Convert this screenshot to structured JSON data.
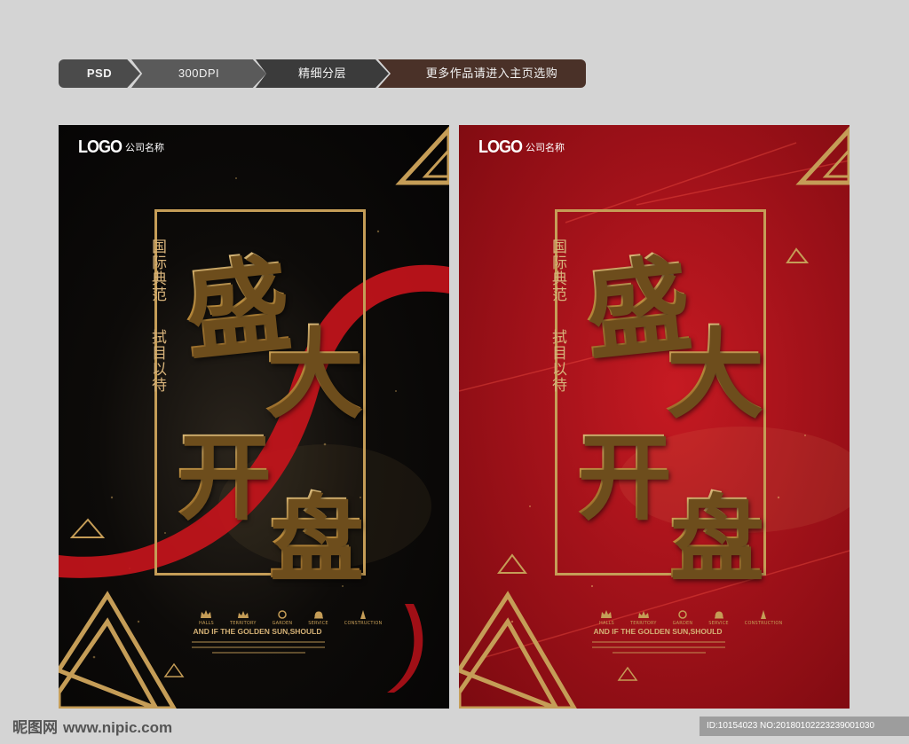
{
  "header": {
    "crumbs": [
      "PSD",
      "300DPI",
      "精细分层",
      "更多作品请进入主页选购"
    ]
  },
  "posters": [
    {
      "variant": "black",
      "logo_mark": "LOGO",
      "logo_name": "公司名称",
      "side_text_1": "国际典范",
      "side_text_2": "拭目以待",
      "title_chars": [
        "盛",
        "大",
        "开",
        "盘"
      ],
      "icon_labels": [
        "HALLS",
        "TERRITORY",
        "GARDEN",
        "SERVICE",
        "CONSTRUCTION"
      ],
      "tagline": "AND IF THE GOLDEN SUN,SHOULD"
    },
    {
      "variant": "red",
      "logo_mark": "LOGO",
      "logo_name": "公司名称",
      "side_text_1": "国际典范",
      "side_text_2": "拭目以待",
      "title_chars": [
        "盛",
        "大",
        "开",
        "盘"
      ],
      "icon_labels": [
        "HALLS",
        "TERRITORY",
        "GARDEN",
        "SERVICE",
        "CONSTRUCTION"
      ],
      "tagline": "AND IF THE GOLDEN SUN,SHOULD"
    }
  ],
  "footer": {
    "brand": "昵图网",
    "site": "www.nipic.com",
    "id_text": "ID:10154023 NO:20180102223239001030"
  },
  "colors": {
    "gold": "#c59d57",
    "poster_black": "#0d0b09",
    "poster_red": "#a3121a",
    "ribbon_red": "#c8141c"
  }
}
